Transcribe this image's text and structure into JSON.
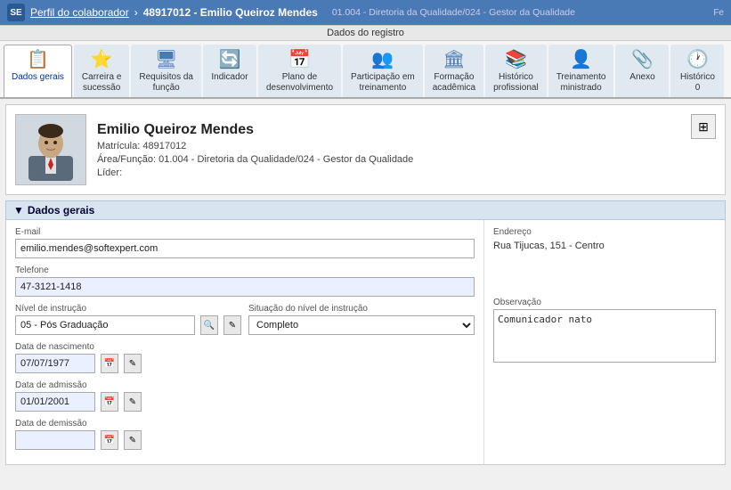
{
  "breadcrumb": {
    "logo_text": "SE",
    "parent": "Perfil do colaborador",
    "separator": "›",
    "current": "48917012 - Emilio Queiroz Mendes",
    "subtitle": "01.004 - Diretoria da Qualidade/024 - Gestor da Qualidade"
  },
  "tabs_label": "Dados do registro",
  "tabs": [
    {
      "id": "dados-gerais",
      "label": "Dados gerais",
      "icon": "📋",
      "active": true
    },
    {
      "id": "carreira",
      "label": "Carreira e\nsucessão",
      "icon": "⭐"
    },
    {
      "id": "requisitos",
      "label": "Requisitos da\nfunção",
      "icon": "🖥"
    },
    {
      "id": "indicador",
      "label": "Indicador",
      "icon": "🔄"
    },
    {
      "id": "plano",
      "label": "Plano de\ndesenvolvimento",
      "icon": "📅"
    },
    {
      "id": "participacao",
      "label": "Participação em\ntreinamento",
      "icon": "👥"
    },
    {
      "id": "formacao",
      "label": "Formação\nacadêmica",
      "icon": "🏛"
    },
    {
      "id": "historico",
      "label": "Histórico\nprofissional",
      "icon": "📚"
    },
    {
      "id": "treinamento",
      "label": "Treinamento\nministrado",
      "icon": "👤"
    },
    {
      "id": "anexo",
      "label": "Anexo",
      "icon": "📎"
    },
    {
      "id": "historico2",
      "label": "Histórico\n0",
      "icon": "🕐"
    }
  ],
  "profile": {
    "name": "Emilio Queiroz Mendes",
    "matricula_label": "Matrícula:",
    "matricula": "48917012",
    "area_label": "Área/Função:",
    "area": "01.004 - Diretoria da Qualidade/024 - Gestor da Qualidade",
    "lider_label": "Líder:"
  },
  "section": {
    "title": "Dados gerais",
    "collapse_icon": "▼"
  },
  "form": {
    "email_label": "E-mail",
    "email_value": "emilio.mendes@softexpert.com",
    "telefone_label": "Telefone",
    "telefone_value": "47-3121-1418",
    "nivel_instrucao_label": "Nível de instrução",
    "nivel_instrucao_value": "05 - Pós Graduação",
    "situacao_label": "Situação do nível de instrução",
    "situacao_value": "Completo",
    "data_nasc_label": "Data de nascimento",
    "data_nasc_value": "07/07/1977",
    "data_admissao_label": "Data de admissão",
    "data_admissao_value": "01/01/2001",
    "data_demissao_label": "Data de demissão",
    "data_demissao_value": "",
    "endereco_label": "Endereço",
    "endereco_value": "Rua Tijucas, 151 - Centro",
    "observacao_label": "Observação",
    "observacao_value": "Comunicador nato"
  },
  "icons": {
    "search": "🔍",
    "edit": "✎",
    "calendar": "📅",
    "grid": "⊞",
    "collapse": "▼"
  }
}
